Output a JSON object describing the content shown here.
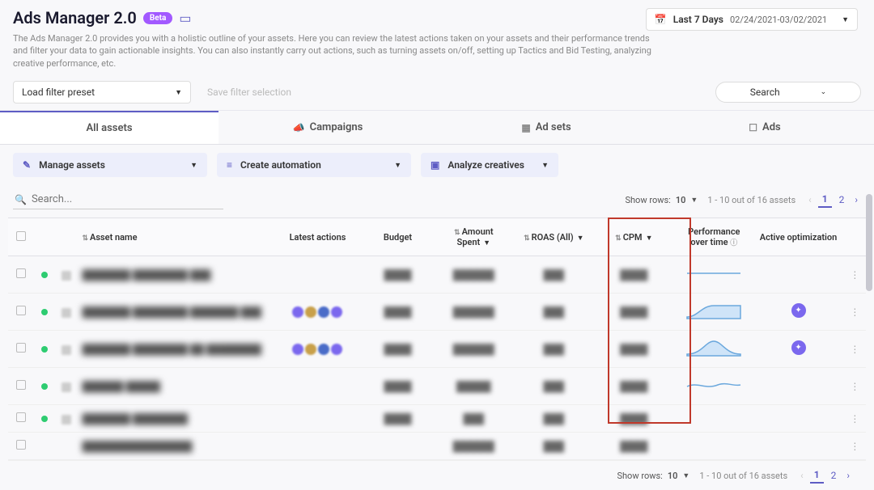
{
  "header": {
    "title": "Ads Manager 2.0",
    "beta": "Beta",
    "subtitle": "The Ads Manager 2.0 provides you with a holistic outline of your assets. Here you can review the latest actions taken on your assets and their performance trends and filter your data to gain actionable insights. You can also instantly carry out actions, such as turning assets on/off, setting up Tactics and Bid Testing, analyzing creative performance, etc."
  },
  "date": {
    "label": "Last 7 Days",
    "range": "02/24/2021-03/02/2021"
  },
  "filter": {
    "preset": "Load filter preset",
    "save": "Save filter selection",
    "search_label": "Search"
  },
  "tabs": [
    {
      "label": "All assets",
      "active": true
    },
    {
      "label": "Campaigns"
    },
    {
      "label": "Ad sets"
    },
    {
      "label": "Ads"
    }
  ],
  "actions": {
    "manage": "Manage assets",
    "automation": "Create automation",
    "creatives": "Analyze creatives"
  },
  "search": {
    "placeholder": "Search..."
  },
  "rowsControl": {
    "label": "Show rows:",
    "value": "10",
    "count": "1 - 10 out of 16 assets",
    "pages": [
      "1",
      "2"
    ]
  },
  "columns": {
    "name": "Asset name",
    "latest": "Latest actions",
    "budget": "Budget",
    "spent": "Amount Spent",
    "roas": "ROAS (All)",
    "cpm": "CPM",
    "perf": "Performance over time",
    "opt": "Active optimization"
  },
  "rows": [
    {
      "status": "on",
      "name": "███████ ████████ ███",
      "latest": "",
      "budget": "████",
      "spent": "██████",
      "roas": "███",
      "cpm": "████",
      "spark": "flat",
      "opt": false
    },
    {
      "status": "on",
      "name": "███████ ████████ ███████ ███",
      "latest": "icons",
      "budget": "████",
      "spent": "██████",
      "roas": "███",
      "cpm": "████",
      "spark": "rise",
      "opt": true
    },
    {
      "status": "on",
      "name": "███████ ████████ ██ ████████",
      "latest": "icons",
      "budget": "████",
      "spent": "██████",
      "roas": "███",
      "cpm": "████",
      "spark": "peak",
      "opt": true
    },
    {
      "status": "on",
      "name": "██████ █████",
      "latest": "",
      "budget": "████",
      "spent": "█████",
      "roas": "███",
      "cpm": "████",
      "spark": "wave",
      "opt": false
    },
    {
      "status": "on",
      "name": "███████ ████████",
      "latest": "",
      "budget": "████",
      "spent": "███",
      "roas": "███",
      "cpm": "████",
      "spark": "",
      "opt": false
    },
    {
      "status": "",
      "name": "████████████████",
      "latest": "",
      "budget": "",
      "spent": "██████",
      "roas": "███",
      "cpm": "████",
      "spark": "",
      "opt": false
    }
  ]
}
